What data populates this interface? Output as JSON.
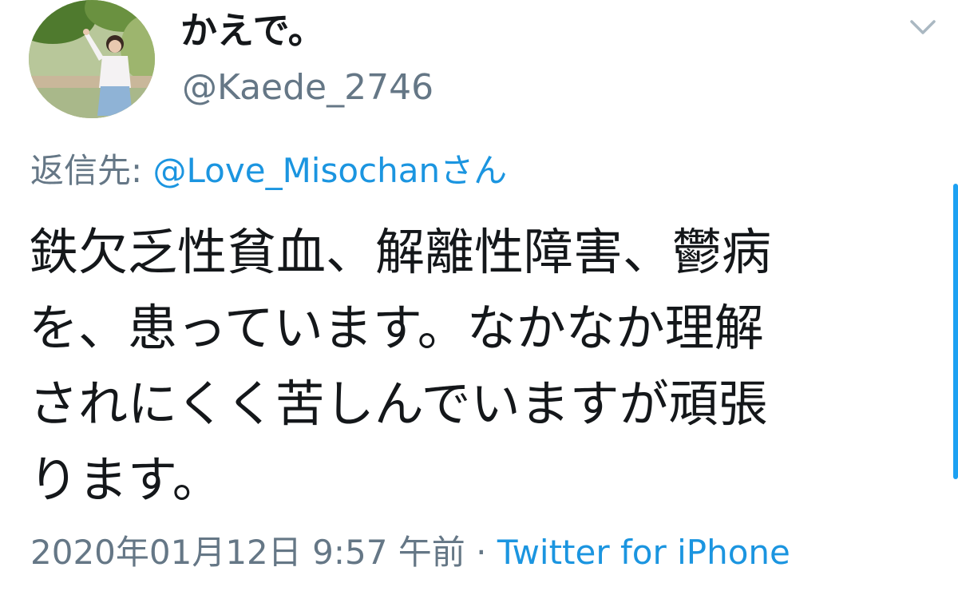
{
  "tweet": {
    "display_name": "かえで。",
    "handle": "@Kaede_2746",
    "reply_prefix": "返信先: ",
    "reply_to": "@Love_Misochanさん",
    "body_lines": [
      "鉄欠乏性貧血、解離性障害、鬱病",
      "を、患っています。なかなか理解",
      "されにくく苦しんでいますが頑張",
      "ります。"
    ],
    "timestamp": "2020年01月12日 9:57 午前",
    "separator": " · ",
    "source": "Twitter for iPhone",
    "menu_icon": "chevron-down-icon",
    "avatar_icon": "avatar-photo"
  },
  "colors": {
    "name": "#14171a",
    "secondary": "#657786",
    "link": "#1b95e0",
    "scrollbar": "#1da1f2"
  }
}
